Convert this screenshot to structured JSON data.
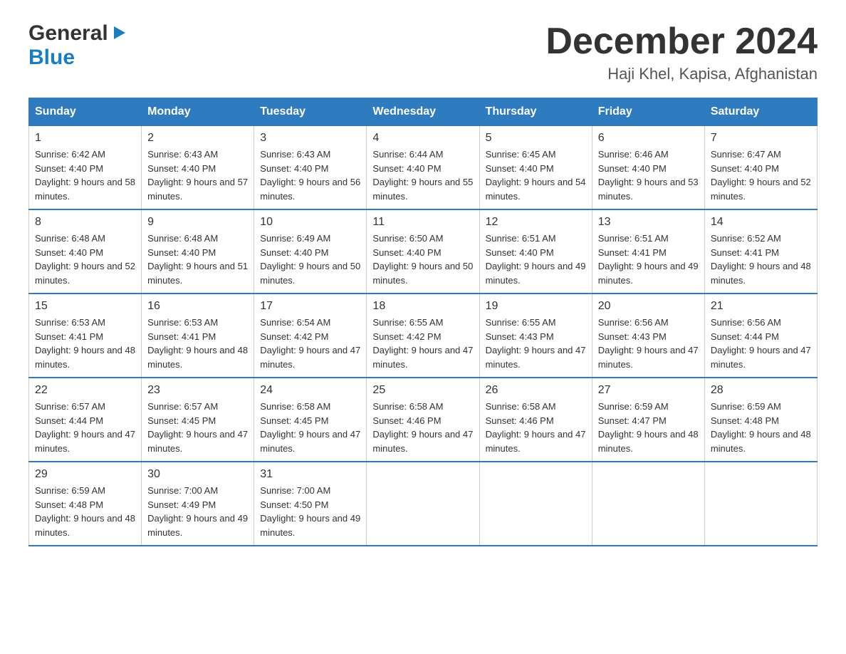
{
  "header": {
    "logo_line1": "General",
    "logo_line2": "Blue",
    "month_title": "December 2024",
    "location": "Haji Khel, Kapisa, Afghanistan"
  },
  "weekdays": [
    "Sunday",
    "Monday",
    "Tuesday",
    "Wednesday",
    "Thursday",
    "Friday",
    "Saturday"
  ],
  "weeks": [
    [
      {
        "day": "1",
        "sunrise": "6:42 AM",
        "sunset": "4:40 PM",
        "daylight": "9 hours and 58 minutes."
      },
      {
        "day": "2",
        "sunrise": "6:43 AM",
        "sunset": "4:40 PM",
        "daylight": "9 hours and 57 minutes."
      },
      {
        "day": "3",
        "sunrise": "6:43 AM",
        "sunset": "4:40 PM",
        "daylight": "9 hours and 56 minutes."
      },
      {
        "day": "4",
        "sunrise": "6:44 AM",
        "sunset": "4:40 PM",
        "daylight": "9 hours and 55 minutes."
      },
      {
        "day": "5",
        "sunrise": "6:45 AM",
        "sunset": "4:40 PM",
        "daylight": "9 hours and 54 minutes."
      },
      {
        "day": "6",
        "sunrise": "6:46 AM",
        "sunset": "4:40 PM",
        "daylight": "9 hours and 53 minutes."
      },
      {
        "day": "7",
        "sunrise": "6:47 AM",
        "sunset": "4:40 PM",
        "daylight": "9 hours and 52 minutes."
      }
    ],
    [
      {
        "day": "8",
        "sunrise": "6:48 AM",
        "sunset": "4:40 PM",
        "daylight": "9 hours and 52 minutes."
      },
      {
        "day": "9",
        "sunrise": "6:48 AM",
        "sunset": "4:40 PM",
        "daylight": "9 hours and 51 minutes."
      },
      {
        "day": "10",
        "sunrise": "6:49 AM",
        "sunset": "4:40 PM",
        "daylight": "9 hours and 50 minutes."
      },
      {
        "day": "11",
        "sunrise": "6:50 AM",
        "sunset": "4:40 PM",
        "daylight": "9 hours and 50 minutes."
      },
      {
        "day": "12",
        "sunrise": "6:51 AM",
        "sunset": "4:40 PM",
        "daylight": "9 hours and 49 minutes."
      },
      {
        "day": "13",
        "sunrise": "6:51 AM",
        "sunset": "4:41 PM",
        "daylight": "9 hours and 49 minutes."
      },
      {
        "day": "14",
        "sunrise": "6:52 AM",
        "sunset": "4:41 PM",
        "daylight": "9 hours and 48 minutes."
      }
    ],
    [
      {
        "day": "15",
        "sunrise": "6:53 AM",
        "sunset": "4:41 PM",
        "daylight": "9 hours and 48 minutes."
      },
      {
        "day": "16",
        "sunrise": "6:53 AM",
        "sunset": "4:41 PM",
        "daylight": "9 hours and 48 minutes."
      },
      {
        "day": "17",
        "sunrise": "6:54 AM",
        "sunset": "4:42 PM",
        "daylight": "9 hours and 47 minutes."
      },
      {
        "day": "18",
        "sunrise": "6:55 AM",
        "sunset": "4:42 PM",
        "daylight": "9 hours and 47 minutes."
      },
      {
        "day": "19",
        "sunrise": "6:55 AM",
        "sunset": "4:43 PM",
        "daylight": "9 hours and 47 minutes."
      },
      {
        "day": "20",
        "sunrise": "6:56 AM",
        "sunset": "4:43 PM",
        "daylight": "9 hours and 47 minutes."
      },
      {
        "day": "21",
        "sunrise": "6:56 AM",
        "sunset": "4:44 PM",
        "daylight": "9 hours and 47 minutes."
      }
    ],
    [
      {
        "day": "22",
        "sunrise": "6:57 AM",
        "sunset": "4:44 PM",
        "daylight": "9 hours and 47 minutes."
      },
      {
        "day": "23",
        "sunrise": "6:57 AM",
        "sunset": "4:45 PM",
        "daylight": "9 hours and 47 minutes."
      },
      {
        "day": "24",
        "sunrise": "6:58 AM",
        "sunset": "4:45 PM",
        "daylight": "9 hours and 47 minutes."
      },
      {
        "day": "25",
        "sunrise": "6:58 AM",
        "sunset": "4:46 PM",
        "daylight": "9 hours and 47 minutes."
      },
      {
        "day": "26",
        "sunrise": "6:58 AM",
        "sunset": "4:46 PM",
        "daylight": "9 hours and 47 minutes."
      },
      {
        "day": "27",
        "sunrise": "6:59 AM",
        "sunset": "4:47 PM",
        "daylight": "9 hours and 48 minutes."
      },
      {
        "day": "28",
        "sunrise": "6:59 AM",
        "sunset": "4:48 PM",
        "daylight": "9 hours and 48 minutes."
      }
    ],
    [
      {
        "day": "29",
        "sunrise": "6:59 AM",
        "sunset": "4:48 PM",
        "daylight": "9 hours and 48 minutes."
      },
      {
        "day": "30",
        "sunrise": "7:00 AM",
        "sunset": "4:49 PM",
        "daylight": "9 hours and 49 minutes."
      },
      {
        "day": "31",
        "sunrise": "7:00 AM",
        "sunset": "4:50 PM",
        "daylight": "9 hours and 49 minutes."
      },
      null,
      null,
      null,
      null
    ]
  ],
  "labels": {
    "sunrise": "Sunrise:",
    "sunset": "Sunset:",
    "daylight": "Daylight:"
  }
}
